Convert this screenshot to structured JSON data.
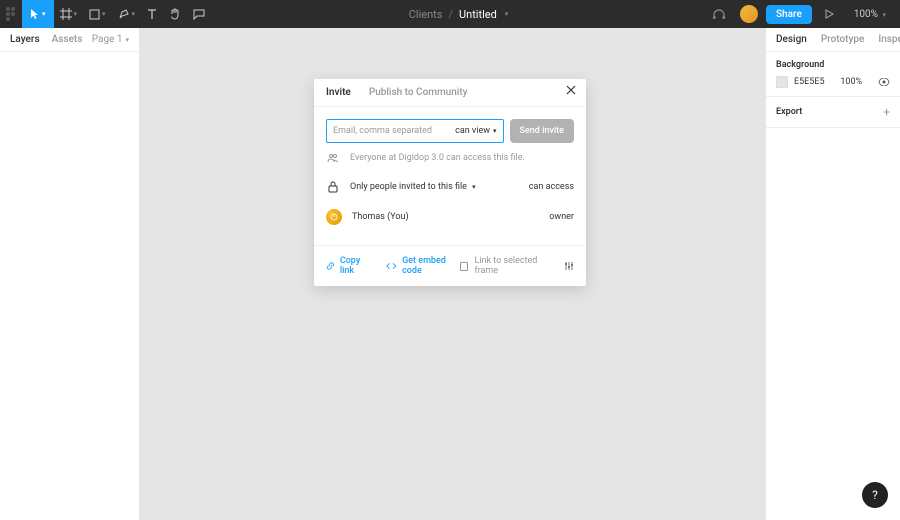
{
  "toolbar": {
    "project": "Clients",
    "filename": "Untitled",
    "share_label": "Share",
    "zoom_label": "100%"
  },
  "left_panel": {
    "tabs": {
      "layers": "Layers",
      "assets": "Assets"
    },
    "page_label": "Page 1"
  },
  "right_panel": {
    "tabs": {
      "design": "Design",
      "prototype": "Prototype",
      "inspect": "Inspect"
    },
    "background": {
      "title": "Background",
      "hex": "E5E5E5",
      "opacity": "100%"
    },
    "export": {
      "title": "Export"
    }
  },
  "modal": {
    "tabs": {
      "invite": "Invite",
      "publish": "Publish to Community"
    },
    "email_placeholder": "Email, comma separated",
    "permission_label": "can view",
    "send_label": "Send invite",
    "everyone_text": "Everyone at Digidop 3.0 can access this file.",
    "access_text": "Only people invited to this file",
    "access_right": "can access",
    "user_name": "Thomas (You)",
    "user_role": "owner",
    "copy_link": "Copy link",
    "embed_code": "Get embed code",
    "link_selected": "Link to selected frame"
  },
  "help_label": "?",
  "colors": {
    "accent": "#18a0fb",
    "canvas": "#E5E5E5"
  }
}
